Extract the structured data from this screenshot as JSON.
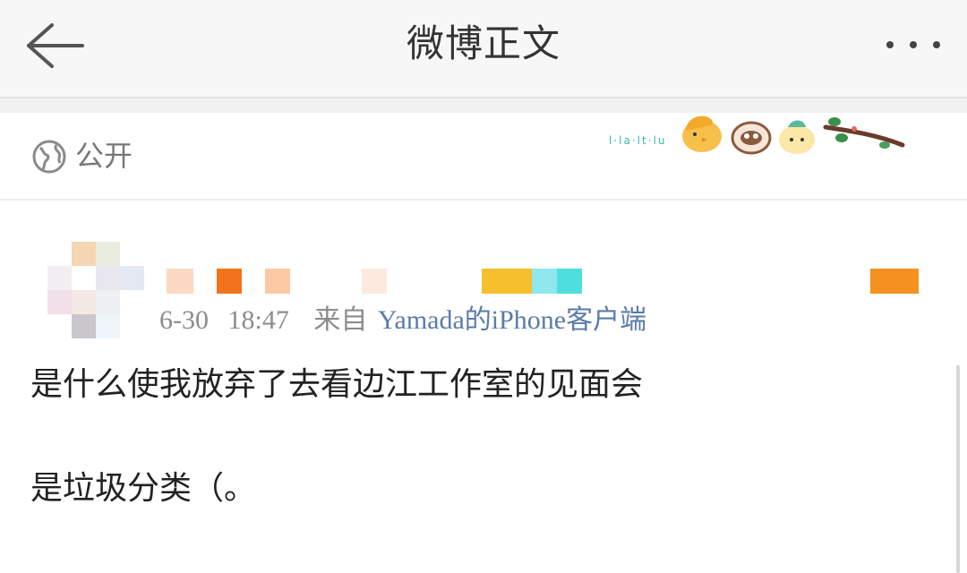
{
  "header": {
    "title": "微博正文",
    "back_icon": "back-arrow-icon",
    "more_icon": "more-dots-icon"
  },
  "visibility": {
    "icon": "globe-icon",
    "label": "公开"
  },
  "card_sticker": {
    "text": "l·la·lt·lu"
  },
  "post": {
    "date": "6-30",
    "time": "18:47",
    "source_prefix": "来自",
    "source": "Yamada的iPhone客户端",
    "lines": [
      "是什么使我放弃了去看边江工作室的见面会",
      "是垃圾分类（。"
    ]
  },
  "colors": {
    "navbar_bg": "#f7f7f7",
    "text_primary": "#222222",
    "meta_gray": "#8c8c8c",
    "source_link": "#5b7ba8"
  }
}
